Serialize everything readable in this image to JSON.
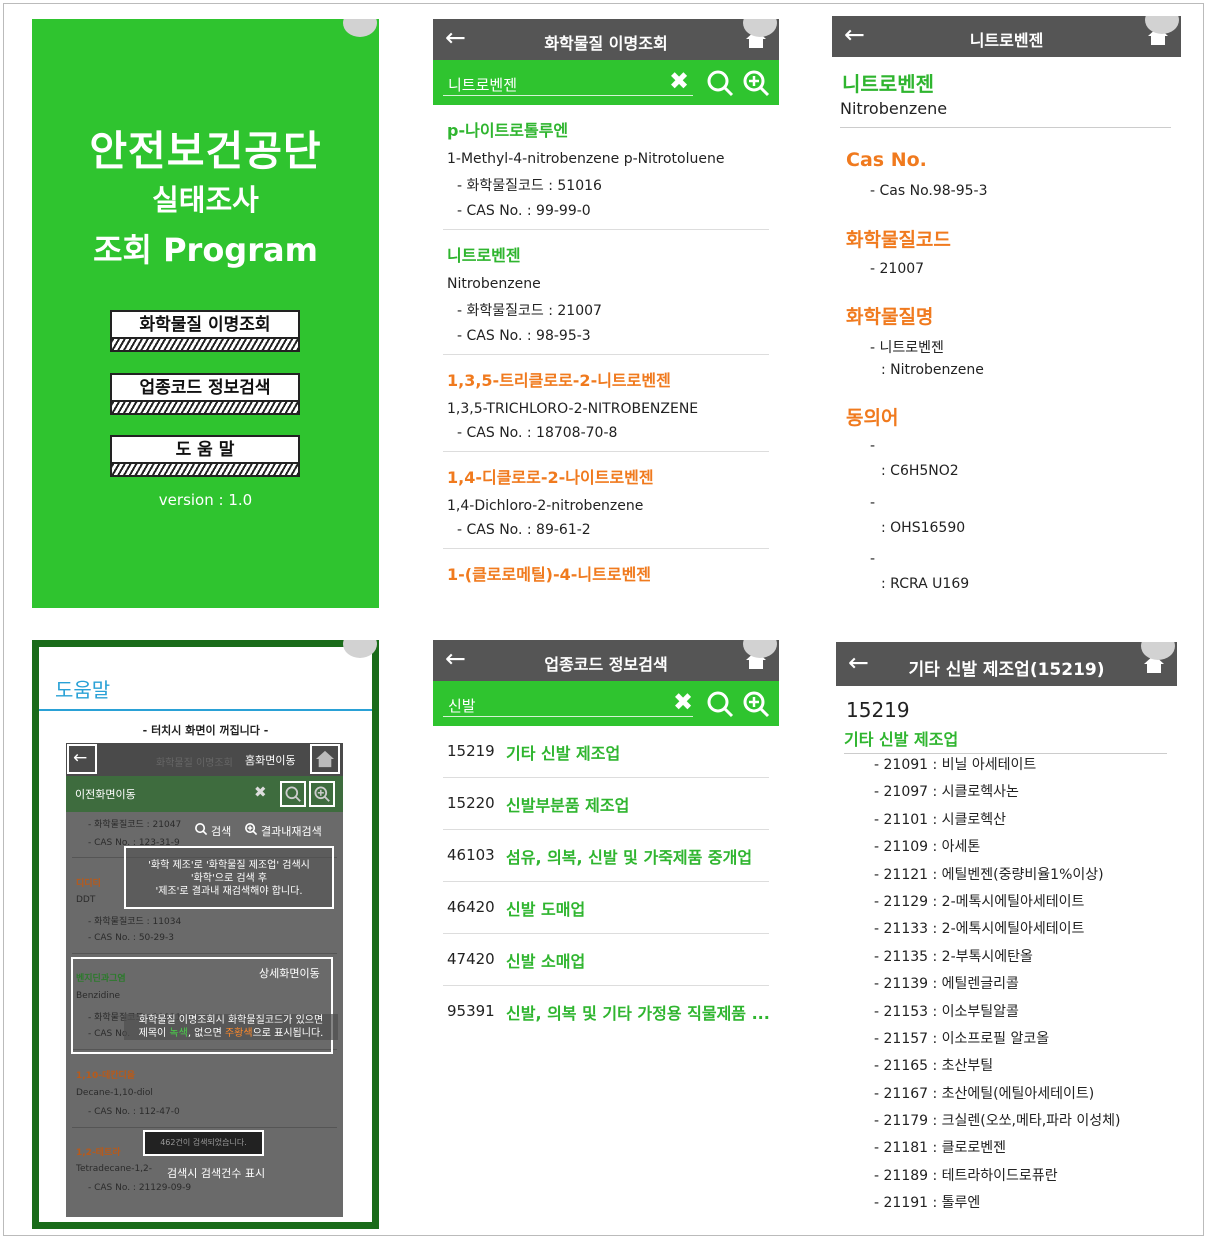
{
  "splash": {
    "title1": "안전보건공단",
    "title2": "실태조사",
    "title3": "조회 Program",
    "buttons": [
      "화학물질 이명조회",
      "업종코드 정보검색",
      "도 움 말"
    ],
    "version": "version : 1.0"
  },
  "search_results": {
    "header_title": "화학물질 이명조회",
    "query": "니트로벤젠",
    "items": [
      {
        "kn": "p-나이트로톨루엔",
        "en": "1-Methyl-4-nitrobenzene  p-Nitrotoluene",
        "code": "- 화학물질코드 : 51016",
        "cas": "- CAS No. : 99-99-0",
        "color": "green"
      },
      {
        "kn": "니트로벤젠",
        "en": "Nitrobenzene",
        "code": "- 화학물질코드 : 21007",
        "cas": "- CAS No. : 98-95-3",
        "color": "green"
      },
      {
        "kn": "1,3,5-트리클로로-2-니트로벤젠",
        "en": "1,3,5-TRICHLORO-2-NITROBENZENE",
        "cas": "- CAS No. : 18708-70-8",
        "color": "orange"
      },
      {
        "kn": "1,4-디클로로-2-나이트로벤젠",
        "en": "1,4-Dichloro-2-nitrobenzene",
        "cas": "- CAS No. : 89-61-2",
        "color": "orange"
      },
      {
        "kn": "1-(클로로메틸)-4-니트로벤젠",
        "color": "orange"
      }
    ]
  },
  "detail": {
    "header_title": "니트로벤젠",
    "name_kn": "니트로벤젠",
    "name_en": "Nitrobenzene",
    "cas_heading": "Cas No.",
    "cas_value": "- Cas No.98-95-3",
    "code_heading": "화학물질코드",
    "code_value": "- 21007",
    "name_heading": "화학물질명",
    "name_value_1": "- 니트로벤젠",
    "name_value_2": ": Nitrobenzene",
    "syn_heading": "동의어",
    "synonyms": [
      {
        "dash": "-",
        "value": ": C6H5NO2"
      },
      {
        "dash": "-",
        "value": ": OHS16590"
      },
      {
        "dash": "-",
        "value": ": RCRA U169"
      }
    ]
  },
  "help": {
    "title": "도움말",
    "tap_note": "- 터치시 화면이 꺼집니다 -",
    "home_move": "홈화면이동",
    "prev_move": "이전화면이동",
    "search": "검색",
    "research": "결과내재검색",
    "search_note": "'화학 제조'로 '화학물질 제조업' 검색시\n'화학'으로 검색 후\n'제조'로 결과내 재검색해야 합니다.",
    "detail_move": "상세화면이동",
    "color_note_1": "화학물질 이명조회시 화학물질코드가 있으면",
    "color_note_2a": "제목이 ",
    "color_note_green": "녹색",
    "color_note_2b": ", 없으면 ",
    "color_note_orange": "주황색",
    "color_note_2c": "으로 표시됩니다.",
    "count_badge": "462건이 검색되었습니다.",
    "count_note": "검색시 검색건수 표시",
    "bg": {
      "header": "화학물질 이명조회",
      "code1": "- 화학물질코드 : 21047",
      "cas1": "- CAS No. : 123-31-9",
      "kn2": "디디티",
      "en2": "DDT",
      "code2": "- 화학물질코드 : 11034",
      "cas2": "- CAS No. : 50-29-3",
      "kn3": "벤지딘과그염",
      "en3": "Benzidine",
      "code3": "- 화학물질코드 : 11021",
      "cas3": "- CAS No.",
      "kn4": "1,10-데칸디올",
      "en4": "Decane-1,10-diol",
      "cas4": "- CAS No. : 112-47-0",
      "kn5": "1,2-테트라",
      "en5": "Tetradecane-1,2-",
      "cas5": "- CAS No. : 21129-09-9"
    }
  },
  "industry_search": {
    "header_title": "업종코드 정보검색",
    "query": "신발",
    "items": [
      {
        "code": "15219",
        "name": "기타 신발 제조업"
      },
      {
        "code": "15220",
        "name": "신발부분품 제조업"
      },
      {
        "code": "46103",
        "name": "섬유, 의복, 신발 및 가죽제품 중개업"
      },
      {
        "code": "46420",
        "name": "신발 도매업"
      },
      {
        "code": "47420",
        "name": "신발 소매업"
      },
      {
        "code": "95391",
        "name": "신발, 의복 및 기타 가정용 직물제품 ..."
      }
    ]
  },
  "industry_detail": {
    "header_title": "기타 신발 제조업(15219)",
    "code": "15219",
    "name": "기타 신발 제조업",
    "chemicals": [
      "- 21091 : 비닐 아세테이트",
      "- 21097 : 시클로헥사논",
      "- 21101 : 시클로헥산",
      "- 21109 : 아세톤",
      "- 21121 : 에틸벤젠(중량비율1%이상)",
      "- 21129 : 2-메톡시에틸아세테이트",
      "- 21133 : 2-에톡시에틸아세테이트",
      "- 21135 : 2-부톡시에탄올",
      "- 21139 : 에틸렌글리콜",
      "- 21153 : 이소부틸알콜",
      "- 21157 : 이소프로필 알코올",
      "- 21165 : 초산부틸",
      "- 21167 : 초산에틸(에틸아세테이트)",
      "- 21179 : 크실렌(오쏘,메타,파라 이성체)",
      "- 21181 : 클로로벤젠",
      "- 21189 : 테트라하이드로퓨란",
      "- 21191 : 톨루엔"
    ]
  },
  "colors": {
    "green": "#2fc42f",
    "orange": "#f07a1e",
    "header": "#555555",
    "help_blue": "#2aa1d6"
  },
  "icons": [
    "back-arrow-icon",
    "home-icon",
    "clear-x-icon",
    "search-icon",
    "zoom-search-icon"
  ]
}
